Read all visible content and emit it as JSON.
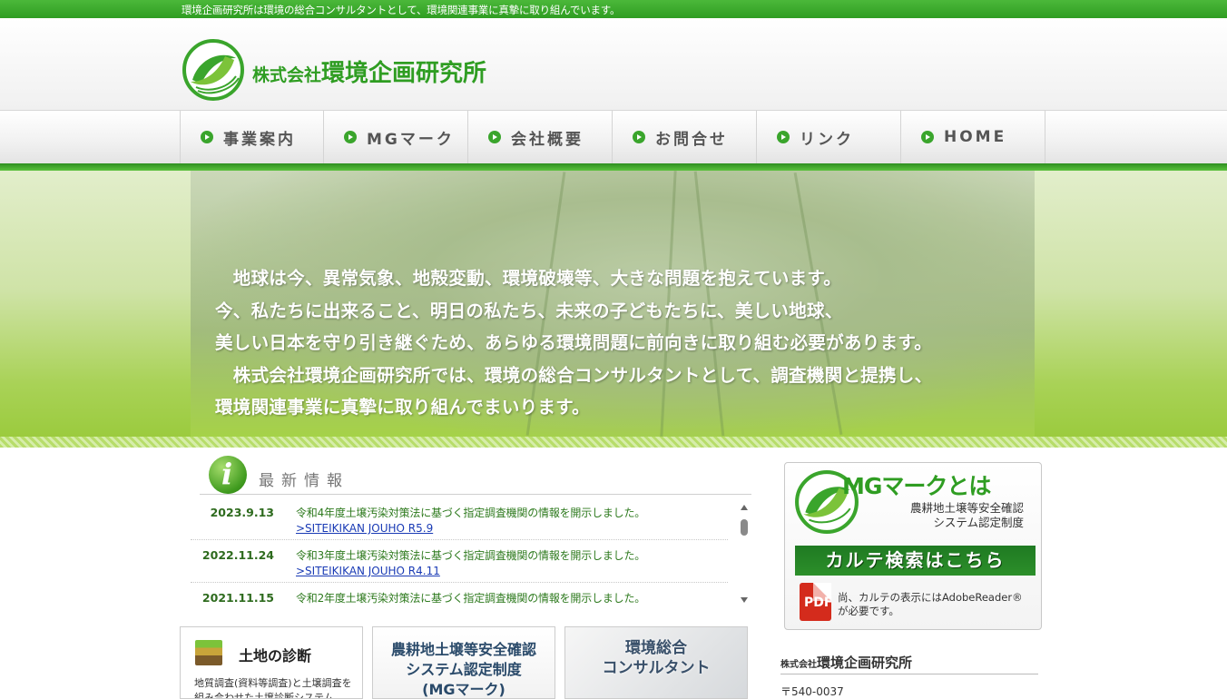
{
  "topbar": {
    "text": "環境企画研究所は環境の総合コンサルタントとして、環境関連事業に真摯に取り組んでいます。"
  },
  "header": {
    "logo_prefix": "株式会社",
    "logo_name": "環境企画研究所",
    "logo_icon": "green-swirl-logo"
  },
  "nav": [
    {
      "label": "事業案内"
    },
    {
      "label": "MGマーク"
    },
    {
      "label": "会社概要"
    },
    {
      "label": "お問合せ"
    },
    {
      "label": "リンク"
    },
    {
      "label": "HOME"
    }
  ],
  "hero": {
    "text": "　地球は今、異常気象、地殻変動、環境破壊等、大きな問題を抱えています。\n今、私たちに出来ること、明日の私たち、未来の子どもたちに、美しい地球、\n美しい日本を守り引き継ぐため、あらゆる環境問題に前向きに取り組む必要があります。\n　株式会社環境企画研究所では、環境の総合コンサルタントとして、調査機関と提携し、\n環境関連事業に真摯に取り組んでまいります。"
  },
  "news": {
    "title": "最新情報",
    "icon": "info-icon",
    "items": [
      {
        "date": "2023.9.13",
        "text": "令和4年度土壌汚染対策法に基づく指定調査機関の情報を開示しました。",
        "link": ">SITEIKIKAN JOUHO R5.9"
      },
      {
        "date": "2022.11.24",
        "text": "令和3年度土壌汚染対策法に基づく指定調査機関の情報を開示しました。",
        "link": ">SITEIKIKAN JOUHO R4.11"
      },
      {
        "date": "2021.11.15",
        "text": "令和2年度土壌汚染対策法に基づく指定調査機関の情報を開示しました。",
        "link": ""
      }
    ]
  },
  "cards": {
    "soil": {
      "title": "土地の診断",
      "desc": "地質調査(資料等調査)と土壌調査を組み合わせた土壌診断システム"
    },
    "mg": {
      "title": "農耕地土壌等安全確認\nシステム認定制度\n(MGマーク)"
    },
    "consult": {
      "title": "環境総合\nコンサルタント"
    }
  },
  "mg_box": {
    "title": "MGマークとは",
    "subtitle": "農耕地土壌等安全確認\nシステム認定制度",
    "karte_button": "カルテ検索はこちら",
    "pdf_label": "PDF",
    "note": "尚、カルテの表示にはAdobeReader®が必要です。"
  },
  "company": {
    "prefix": "株式会社",
    "name": "環境企画研究所",
    "zip": "〒540-0037"
  },
  "colors": {
    "brand_green": "#2f9d22",
    "link_blue": "#1a3bb5",
    "karte_green": "#1f7a22"
  }
}
